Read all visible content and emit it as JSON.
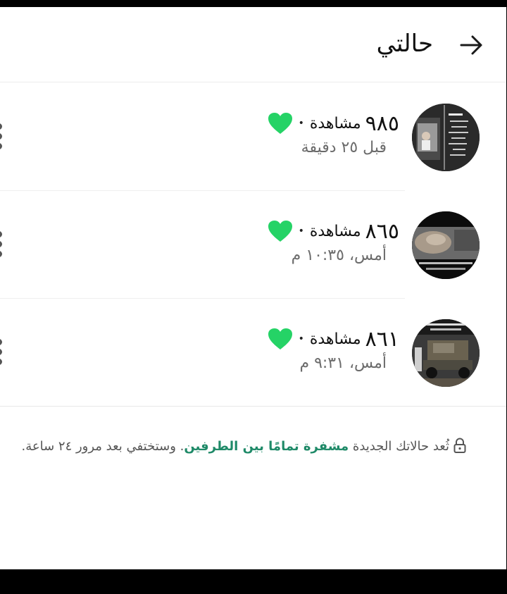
{
  "header": {
    "title": "حالتي",
    "back_icon": "arrow-back-icon"
  },
  "statuses": [
    {
      "views": "٩٨٥",
      "views_label": "مشاهدة",
      "bullet": "•",
      "time": "قبل ٢٥ دقيقة"
    },
    {
      "views": "٨٦٥",
      "views_label": "مشاهدة",
      "bullet": "•",
      "time": "أمس، ١٠:٣٥ م"
    },
    {
      "views": "٨٦١",
      "views_label": "مشاهدة",
      "bullet": "•",
      "time": "أمس، ٩:٣١ م"
    }
  ],
  "footer": {
    "prefix": "ثُعد حالاتك الجديدة",
    "link": "مشفرة تمامًا بين الطرفين",
    "suffix": ". وستختفي بعد مرور ٢٤ ساعة."
  },
  "colors": {
    "accent": "#1f8a68",
    "heart": "#25d366"
  }
}
